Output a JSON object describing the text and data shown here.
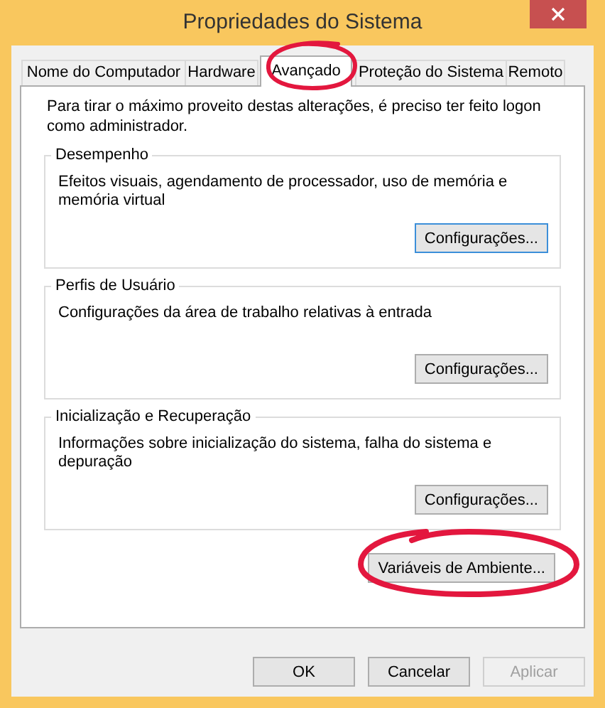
{
  "window": {
    "title": "Propriedades do Sistema"
  },
  "tabs": [
    {
      "label": "Nome do Computador",
      "selected": false
    },
    {
      "label": "Hardware",
      "selected": false
    },
    {
      "label": "Avançado",
      "selected": true
    },
    {
      "label": "Proteção do Sistema",
      "selected": false
    },
    {
      "label": "Remoto",
      "selected": false
    }
  ],
  "intro": "Para tirar o máximo proveito destas alterações, é preciso ter feito logon como administrador.",
  "groups": [
    {
      "title": "Desempenho",
      "description": "Efeitos visuais, agendamento de processador, uso de memória e memória virtual",
      "button": "Configurações...",
      "focused": true
    },
    {
      "title": "Perfis de Usuário",
      "description": "Configurações da área de trabalho relativas à entrada",
      "button": "Configurações...",
      "focused": false
    },
    {
      "title": "Inicialização e Recuperação",
      "description": "Informações sobre inicialização do sistema, falha do sistema e depuração",
      "button": "Configurações...",
      "focused": false
    }
  ],
  "env_button": "Variáveis de Ambiente...",
  "buttons": [
    {
      "label": "OK",
      "disabled": false
    },
    {
      "label": "Cancelar",
      "disabled": false
    },
    {
      "label": "Aplicar",
      "disabled": true
    }
  ]
}
